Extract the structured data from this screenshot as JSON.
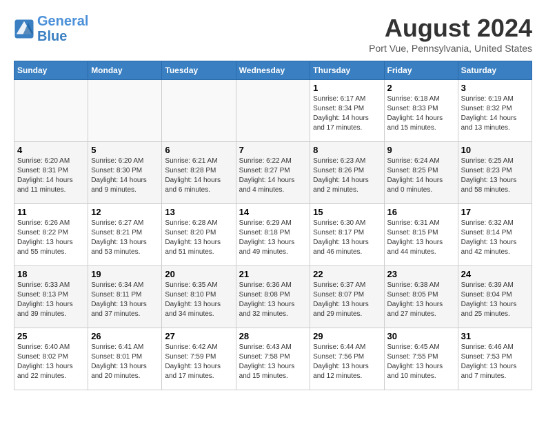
{
  "header": {
    "logo_line1": "General",
    "logo_line2": "Blue",
    "month_title": "August 2024",
    "subtitle": "Port Vue, Pennsylvania, United States"
  },
  "weekdays": [
    "Sunday",
    "Monday",
    "Tuesday",
    "Wednesday",
    "Thursday",
    "Friday",
    "Saturday"
  ],
  "weeks": [
    [
      {
        "day": "",
        "info": ""
      },
      {
        "day": "",
        "info": ""
      },
      {
        "day": "",
        "info": ""
      },
      {
        "day": "",
        "info": ""
      },
      {
        "day": "1",
        "info": "Sunrise: 6:17 AM\nSunset: 8:34 PM\nDaylight: 14 hours\nand 17 minutes."
      },
      {
        "day": "2",
        "info": "Sunrise: 6:18 AM\nSunset: 8:33 PM\nDaylight: 14 hours\nand 15 minutes."
      },
      {
        "day": "3",
        "info": "Sunrise: 6:19 AM\nSunset: 8:32 PM\nDaylight: 14 hours\nand 13 minutes."
      }
    ],
    [
      {
        "day": "4",
        "info": "Sunrise: 6:20 AM\nSunset: 8:31 PM\nDaylight: 14 hours\nand 11 minutes."
      },
      {
        "day": "5",
        "info": "Sunrise: 6:20 AM\nSunset: 8:30 PM\nDaylight: 14 hours\nand 9 minutes."
      },
      {
        "day": "6",
        "info": "Sunrise: 6:21 AM\nSunset: 8:28 PM\nDaylight: 14 hours\nand 6 minutes."
      },
      {
        "day": "7",
        "info": "Sunrise: 6:22 AM\nSunset: 8:27 PM\nDaylight: 14 hours\nand 4 minutes."
      },
      {
        "day": "8",
        "info": "Sunrise: 6:23 AM\nSunset: 8:26 PM\nDaylight: 14 hours\nand 2 minutes."
      },
      {
        "day": "9",
        "info": "Sunrise: 6:24 AM\nSunset: 8:25 PM\nDaylight: 14 hours\nand 0 minutes."
      },
      {
        "day": "10",
        "info": "Sunrise: 6:25 AM\nSunset: 8:23 PM\nDaylight: 13 hours\nand 58 minutes."
      }
    ],
    [
      {
        "day": "11",
        "info": "Sunrise: 6:26 AM\nSunset: 8:22 PM\nDaylight: 13 hours\nand 55 minutes."
      },
      {
        "day": "12",
        "info": "Sunrise: 6:27 AM\nSunset: 8:21 PM\nDaylight: 13 hours\nand 53 minutes."
      },
      {
        "day": "13",
        "info": "Sunrise: 6:28 AM\nSunset: 8:20 PM\nDaylight: 13 hours\nand 51 minutes."
      },
      {
        "day": "14",
        "info": "Sunrise: 6:29 AM\nSunset: 8:18 PM\nDaylight: 13 hours\nand 49 minutes."
      },
      {
        "day": "15",
        "info": "Sunrise: 6:30 AM\nSunset: 8:17 PM\nDaylight: 13 hours\nand 46 minutes."
      },
      {
        "day": "16",
        "info": "Sunrise: 6:31 AM\nSunset: 8:15 PM\nDaylight: 13 hours\nand 44 minutes."
      },
      {
        "day": "17",
        "info": "Sunrise: 6:32 AM\nSunset: 8:14 PM\nDaylight: 13 hours\nand 42 minutes."
      }
    ],
    [
      {
        "day": "18",
        "info": "Sunrise: 6:33 AM\nSunset: 8:13 PM\nDaylight: 13 hours\nand 39 minutes."
      },
      {
        "day": "19",
        "info": "Sunrise: 6:34 AM\nSunset: 8:11 PM\nDaylight: 13 hours\nand 37 minutes."
      },
      {
        "day": "20",
        "info": "Sunrise: 6:35 AM\nSunset: 8:10 PM\nDaylight: 13 hours\nand 34 minutes."
      },
      {
        "day": "21",
        "info": "Sunrise: 6:36 AM\nSunset: 8:08 PM\nDaylight: 13 hours\nand 32 minutes."
      },
      {
        "day": "22",
        "info": "Sunrise: 6:37 AM\nSunset: 8:07 PM\nDaylight: 13 hours\nand 29 minutes."
      },
      {
        "day": "23",
        "info": "Sunrise: 6:38 AM\nSunset: 8:05 PM\nDaylight: 13 hours\nand 27 minutes."
      },
      {
        "day": "24",
        "info": "Sunrise: 6:39 AM\nSunset: 8:04 PM\nDaylight: 13 hours\nand 25 minutes."
      }
    ],
    [
      {
        "day": "25",
        "info": "Sunrise: 6:40 AM\nSunset: 8:02 PM\nDaylight: 13 hours\nand 22 minutes."
      },
      {
        "day": "26",
        "info": "Sunrise: 6:41 AM\nSunset: 8:01 PM\nDaylight: 13 hours\nand 20 minutes."
      },
      {
        "day": "27",
        "info": "Sunrise: 6:42 AM\nSunset: 7:59 PM\nDaylight: 13 hours\nand 17 minutes."
      },
      {
        "day": "28",
        "info": "Sunrise: 6:43 AM\nSunset: 7:58 PM\nDaylight: 13 hours\nand 15 minutes."
      },
      {
        "day": "29",
        "info": "Sunrise: 6:44 AM\nSunset: 7:56 PM\nDaylight: 13 hours\nand 12 minutes."
      },
      {
        "day": "30",
        "info": "Sunrise: 6:45 AM\nSunset: 7:55 PM\nDaylight: 13 hours\nand 10 minutes."
      },
      {
        "day": "31",
        "info": "Sunrise: 6:46 AM\nSunset: 7:53 PM\nDaylight: 13 hours\nand 7 minutes."
      }
    ]
  ]
}
